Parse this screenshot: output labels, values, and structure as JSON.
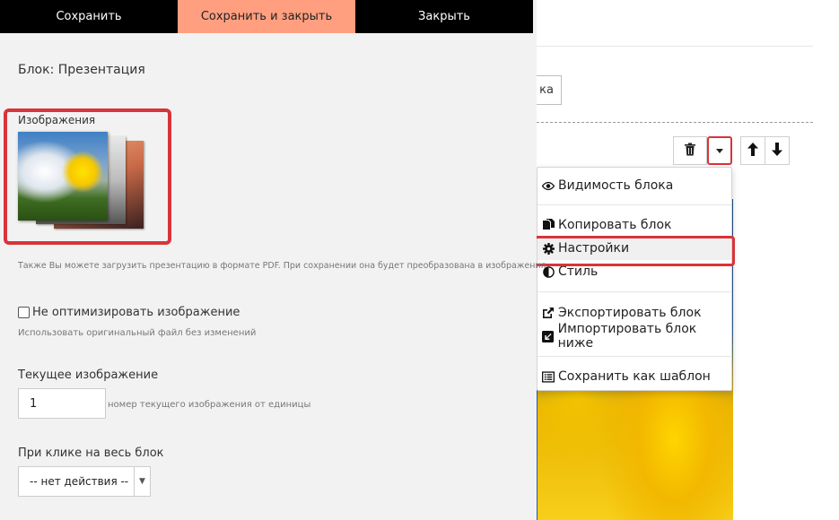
{
  "toolbar": {
    "save_label": "Сохранить",
    "save_close_label": "Сохранить и закрыть",
    "close_label": "Закрыть"
  },
  "panel": {
    "title": "Блок: Презентация",
    "images_label": "Изображения",
    "pdf_hint": "Также Вы можете загрузить презентацию в формате PDF. При сохранении она будет преобразована в изображения",
    "no_optimize_label": "Не оптимизировать изображение",
    "no_optimize_checked": false,
    "no_optimize_hint": "Использовать оригинальный файл без изменений",
    "current_image_label": "Текущее изображение",
    "current_image_value": "1",
    "current_image_hint": "номер текущего изображения от единицы",
    "on_click_label": "При клике на весь блок",
    "on_click_value": "-- нет действия --"
  },
  "background": {
    "partial_button_text": "ка"
  },
  "block_controls": {
    "delete_icon": "trash-icon",
    "dropdown_icon": "caret-down-icon",
    "up_icon": "arrow-up-icon",
    "down_icon": "arrow-down-icon"
  },
  "menu": {
    "items": [
      {
        "label": "Видимость блока",
        "icon": "eye-icon"
      },
      {
        "label": "Копировать блок",
        "icon": "copy-icon"
      },
      {
        "label": "Настройки",
        "icon": "gear-icon"
      },
      {
        "label": "Стиль",
        "icon": "contrast-icon"
      },
      {
        "label": "Экспортировать блок",
        "icon": "external-link-icon"
      },
      {
        "label": "Импортировать блок ниже",
        "icon": "import-icon"
      },
      {
        "label": "Сохранить как шаблон",
        "icon": "list-icon"
      }
    ]
  },
  "colors": {
    "accent_salmon": "#ff9f80",
    "highlight_red": "#d8343a",
    "toolbar_black": "#000000",
    "panel_bg": "#f2f2f2"
  }
}
